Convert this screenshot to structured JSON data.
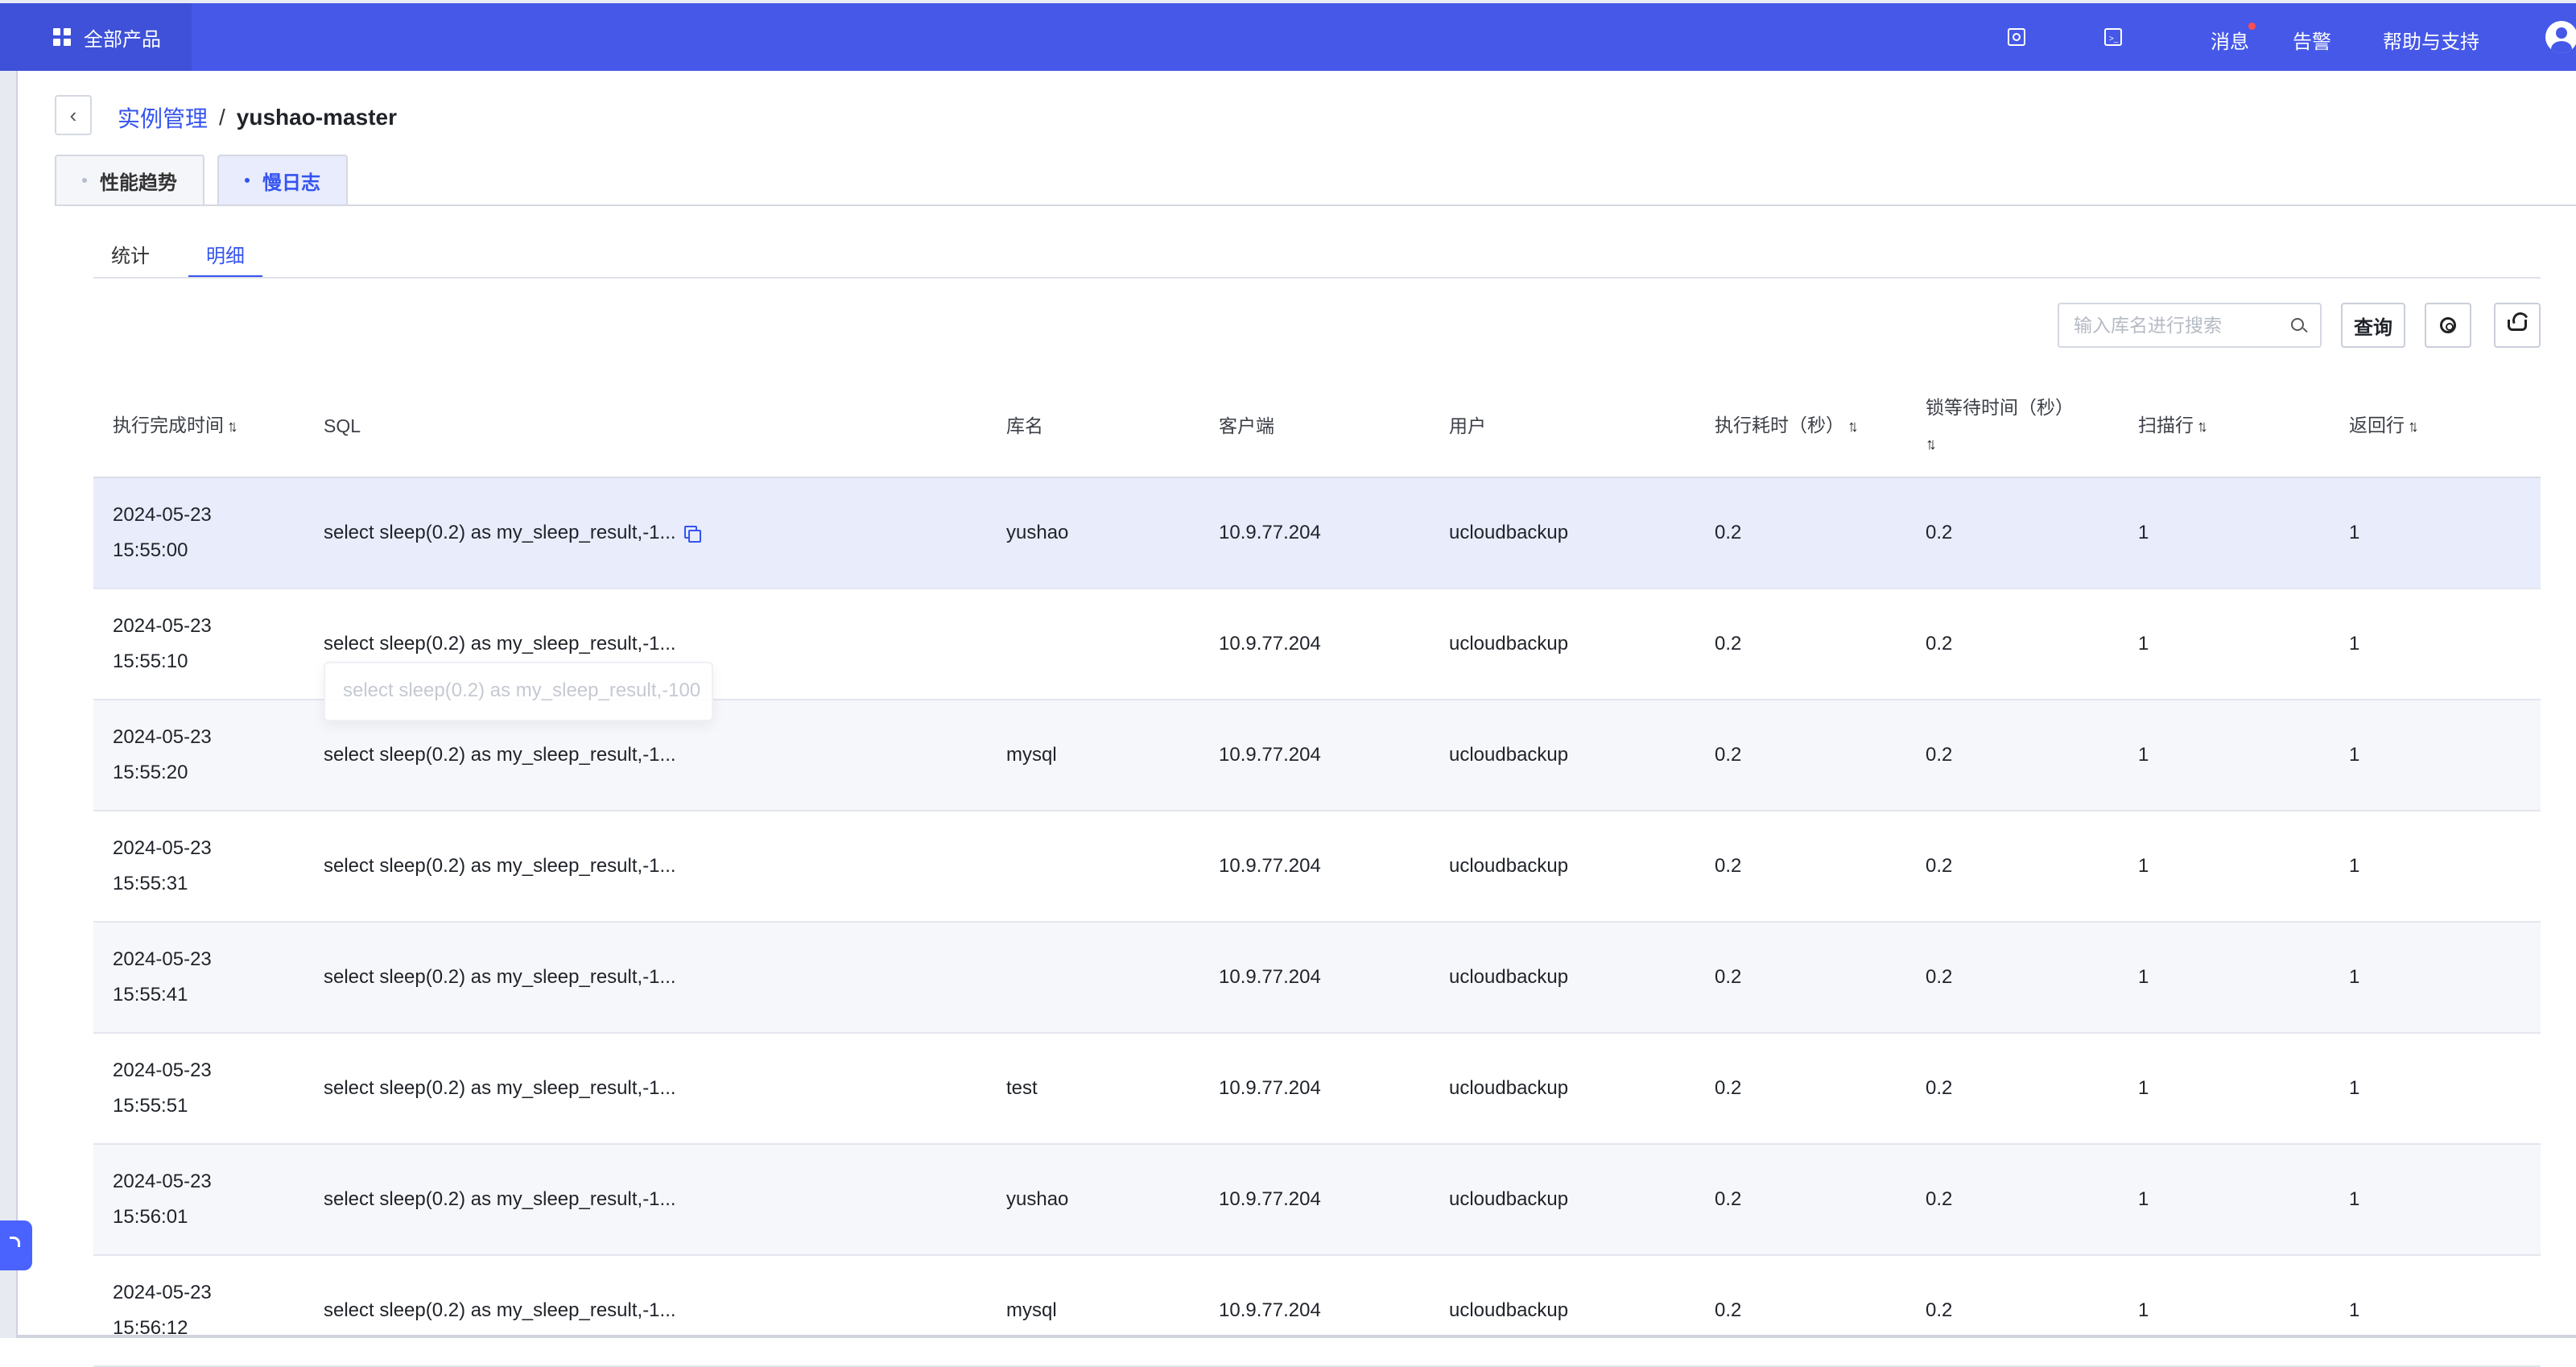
{
  "topbar": {
    "all_products": "全部产品",
    "message": "消息",
    "alert": "告警",
    "help": "帮助与支持"
  },
  "header": {
    "breadcrumb_parent": "实例管理",
    "breadcrumb_sep": "/",
    "instance_name": "yushao-master"
  },
  "page_tabs": [
    {
      "label": "性能趋势",
      "active": false
    },
    {
      "label": "慢日志",
      "active": true
    }
  ],
  "sub_tabs": [
    {
      "label": "统计",
      "active": false
    },
    {
      "label": "明细",
      "active": true
    }
  ],
  "toolbar": {
    "search_placeholder": "输入库名进行搜索",
    "query_label": "查询",
    "settings_icon": "gear-icon",
    "refresh_icon": "cloud-refresh-icon"
  },
  "table": {
    "columns": [
      {
        "label": "执行完成时间",
        "sortable": true
      },
      {
        "label": "SQL",
        "sortable": false
      },
      {
        "label": "库名",
        "sortable": false
      },
      {
        "label": "客户端",
        "sortable": false
      },
      {
        "label": "用户",
        "sortable": false
      },
      {
        "label": "执行耗时（秒）",
        "sortable": true
      },
      {
        "label": "锁等待时间（秒）",
        "sortable": true
      },
      {
        "label": "扫描行",
        "sortable": true
      },
      {
        "label": "返回行",
        "sortable": true
      }
    ],
    "rows": [
      {
        "date": "2024-05-23",
        "time": "15:55:00",
        "sql": "select sleep(0.2) as my_sleep_result,-1...",
        "db": "yushao",
        "client": "10.9.77.204",
        "user": "ucloudbackup",
        "duration": "0.2",
        "lock_wait": "0.2",
        "rows_examined": "1",
        "rows_sent": "1"
      },
      {
        "date": "2024-05-23",
        "time": "15:55:10",
        "sql": "select sleep(0.2) as my_sleep_result,-1...",
        "db": "",
        "client": "10.9.77.204",
        "user": "ucloudbackup",
        "duration": "0.2",
        "lock_wait": "0.2",
        "rows_examined": "1",
        "rows_sent": "1"
      },
      {
        "date": "2024-05-23",
        "time": "15:55:20",
        "sql": "select sleep(0.2) as my_sleep_result,-1...",
        "db": "mysql",
        "client": "10.9.77.204",
        "user": "ucloudbackup",
        "duration": "0.2",
        "lock_wait": "0.2",
        "rows_examined": "1",
        "rows_sent": "1"
      },
      {
        "date": "2024-05-23",
        "time": "15:55:31",
        "sql": "select sleep(0.2) as my_sleep_result,-1...",
        "db": "",
        "client": "10.9.77.204",
        "user": "ucloudbackup",
        "duration": "0.2",
        "lock_wait": "0.2",
        "rows_examined": "1",
        "rows_sent": "1"
      },
      {
        "date": "2024-05-23",
        "time": "15:55:41",
        "sql": "select sleep(0.2) as my_sleep_result,-1...",
        "db": "",
        "client": "10.9.77.204",
        "user": "ucloudbackup",
        "duration": "0.2",
        "lock_wait": "0.2",
        "rows_examined": "1",
        "rows_sent": "1"
      },
      {
        "date": "2024-05-23",
        "time": "15:55:51",
        "sql": "select sleep(0.2) as my_sleep_result,-1...",
        "db": "test",
        "client": "10.9.77.204",
        "user": "ucloudbackup",
        "duration": "0.2",
        "lock_wait": "0.2",
        "rows_examined": "1",
        "rows_sent": "1"
      },
      {
        "date": "2024-05-23",
        "time": "15:56:01",
        "sql": "select sleep(0.2) as my_sleep_result,-1...",
        "db": "yushao",
        "client": "10.9.77.204",
        "user": "ucloudbackup",
        "duration": "0.2",
        "lock_wait": "0.2",
        "rows_examined": "1",
        "rows_sent": "1"
      },
      {
        "date": "2024-05-23",
        "time": "15:56:12",
        "sql": "select sleep(0.2) as my_sleep_result,-1...",
        "db": "mysql",
        "client": "10.9.77.204",
        "user": "ucloudbackup",
        "duration": "0.2",
        "lock_wait": "0.2",
        "rows_examined": "1",
        "rows_sent": "1"
      }
    ]
  },
  "tooltip": {
    "text": "select sleep(0.2) as my_sleep_result,-100"
  },
  "colors": {
    "topbar": "#4558e8",
    "accent": "#3453f0",
    "row_hover": "#e8ecfb",
    "row_alt": "#f6f7fa"
  }
}
